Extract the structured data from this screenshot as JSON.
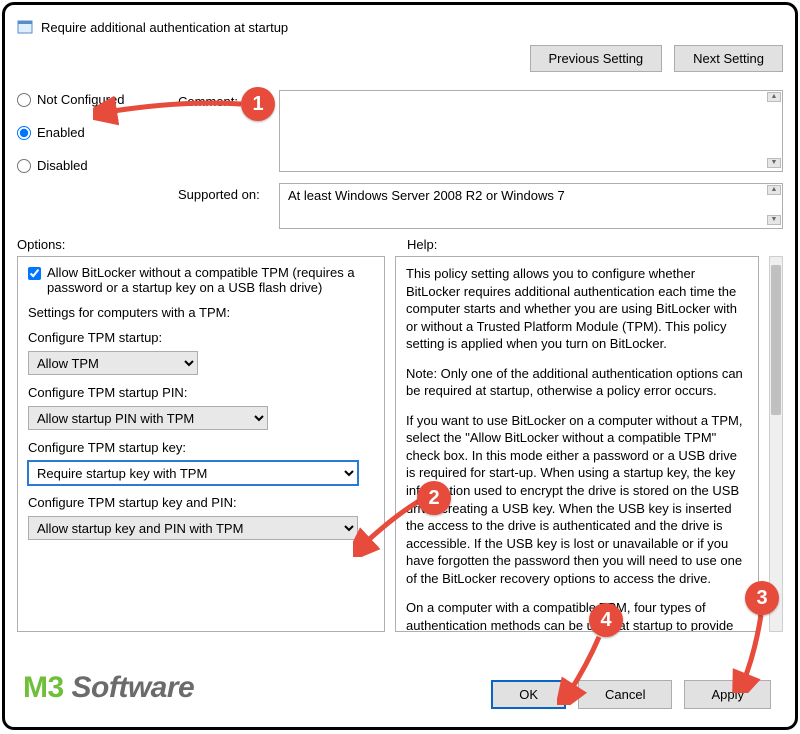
{
  "title": "Require additional authentication at startup",
  "nav": {
    "prev": "Previous Setting",
    "next": "Next Setting"
  },
  "state": {
    "not_configured": "Not Configured",
    "enabled": "Enabled",
    "disabled": "Disabled",
    "selected": "enabled"
  },
  "labels": {
    "comment": "Comment:",
    "supported": "Supported on:",
    "options": "Options:",
    "help": "Help:"
  },
  "supported_text": "At least Windows Server 2008 R2 or Windows 7",
  "options": {
    "allow_no_tpm_label": "Allow BitLocker without a compatible TPM (requires a password or a startup key on a USB flash drive)",
    "allow_no_tpm_checked": true,
    "section_tpm": "Settings for computers with a TPM:",
    "cfg_tpm_startup": "Configure TPM startup:",
    "cfg_tpm_startup_val": "Allow TPM",
    "cfg_tpm_pin": "Configure TPM startup PIN:",
    "cfg_tpm_pin_val": "Allow startup PIN with TPM",
    "cfg_tpm_key": "Configure TPM startup key:",
    "cfg_tpm_key_val": "Require startup key with TPM",
    "cfg_tpm_keypin": "Configure TPM startup key and PIN:",
    "cfg_tpm_keypin_val": "Allow startup key and PIN with TPM"
  },
  "help": {
    "p1": "This policy setting allows you to configure whether BitLocker requires additional authentication each time the computer starts and whether you are using BitLocker with or without a Trusted Platform Module (TPM). This policy setting is applied when you turn on BitLocker.",
    "p2": "Note: Only one of the additional authentication options can be required at startup, otherwise a policy error occurs.",
    "p3": "If you want to use BitLocker on a computer without a TPM, select the \"Allow BitLocker without a compatible TPM\" check box. In this mode either a password or a USB drive is required for start-up. When using a startup key, the key information used to encrypt the drive is stored on the USB drive, creating a USB key. When the USB key is inserted the access to the drive is authenticated and the drive is accessible. If the USB key is lost or unavailable or if you have forgotten the password then you will need to use one of the BitLocker recovery options to access the drive.",
    "p4": "On a computer with a compatible TPM, four types of authentication methods can be used at startup to provide added"
  },
  "buttons": {
    "ok": "OK",
    "cancel": "Cancel",
    "apply": "Apply"
  },
  "watermark": {
    "brand1": "M3",
    "brand2": " Software"
  },
  "annotations": {
    "b1": "1",
    "b2": "2",
    "b3": "3",
    "b4": "4"
  }
}
